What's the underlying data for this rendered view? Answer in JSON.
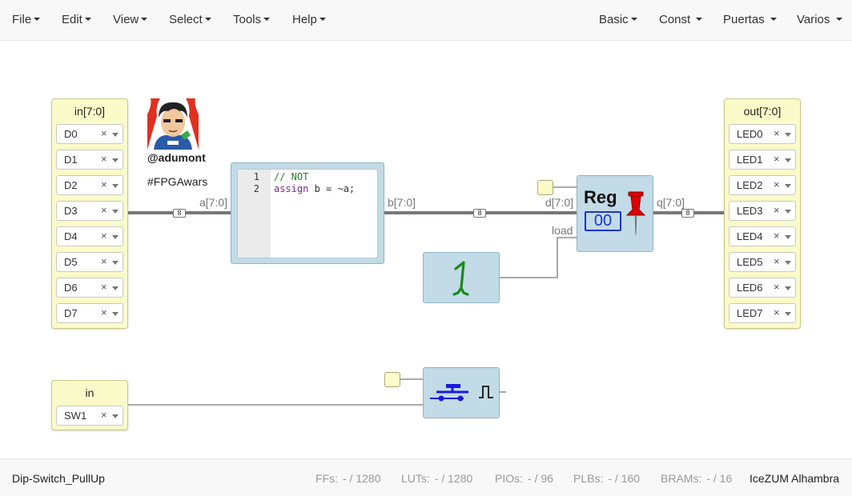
{
  "menu": {
    "left": [
      "File",
      "Edit",
      "View",
      "Select",
      "Tools",
      "Help"
    ],
    "right": [
      "Basic",
      "Const",
      "Puertas",
      "Varios"
    ]
  },
  "input_bus": {
    "title": "in[7:0]",
    "pins": [
      "D0",
      "D1",
      "D2",
      "D3",
      "D4",
      "D5",
      "D6",
      "D7"
    ]
  },
  "output_bus": {
    "title": "out[7:0]",
    "pins": [
      "LED0",
      "LED1",
      "LED2",
      "LED3",
      "LED4",
      "LED5",
      "LED6",
      "LED7"
    ]
  },
  "input_switch": {
    "title": "in",
    "pin": "SW1"
  },
  "pin_clear_glyph": "×",
  "comment": {
    "handle": "@adumont",
    "hashtag": "#FPGAwars"
  },
  "code_block": {
    "line_numbers": [
      "1",
      "2"
    ],
    "line1_comment": "// NOT",
    "line2_keyword": "assign",
    "line2_rest": " b = ~a;"
  },
  "wires": {
    "a_label": "a[7:0]",
    "b_label": "b[7:0]",
    "d_label": "d[7:0]",
    "q_label": "q[7:0]",
    "load_label": "load",
    "bus_width": "8"
  },
  "register": {
    "title": "Reg",
    "value": "00",
    "pin_color": "#e00000",
    "value_color": "#1a33d6"
  },
  "status": {
    "project": "Dip-Switch_PullUp",
    "ffs_label": "FFs:",
    "ffs_value": "- / 1280",
    "luts_label": "LUTs:",
    "luts_value": "- / 1280",
    "pios_label": "PIOs:",
    "pios_value": "- / 96",
    "plbs_label": "PLBs:",
    "plbs_value": "- / 160",
    "brams_label": "BRAMs:",
    "brams_value": "- / 16",
    "board": "IceZUM Alhambra"
  },
  "icons": [
    "constant-one-icon",
    "pushbutton-icon",
    "pulse-icon",
    "pushpin-icon",
    "avatar-image"
  ],
  "colors": {
    "io_block": "#fbfbc9",
    "logic_block": "#c2dbe6",
    "bus_wire": "#777777"
  }
}
